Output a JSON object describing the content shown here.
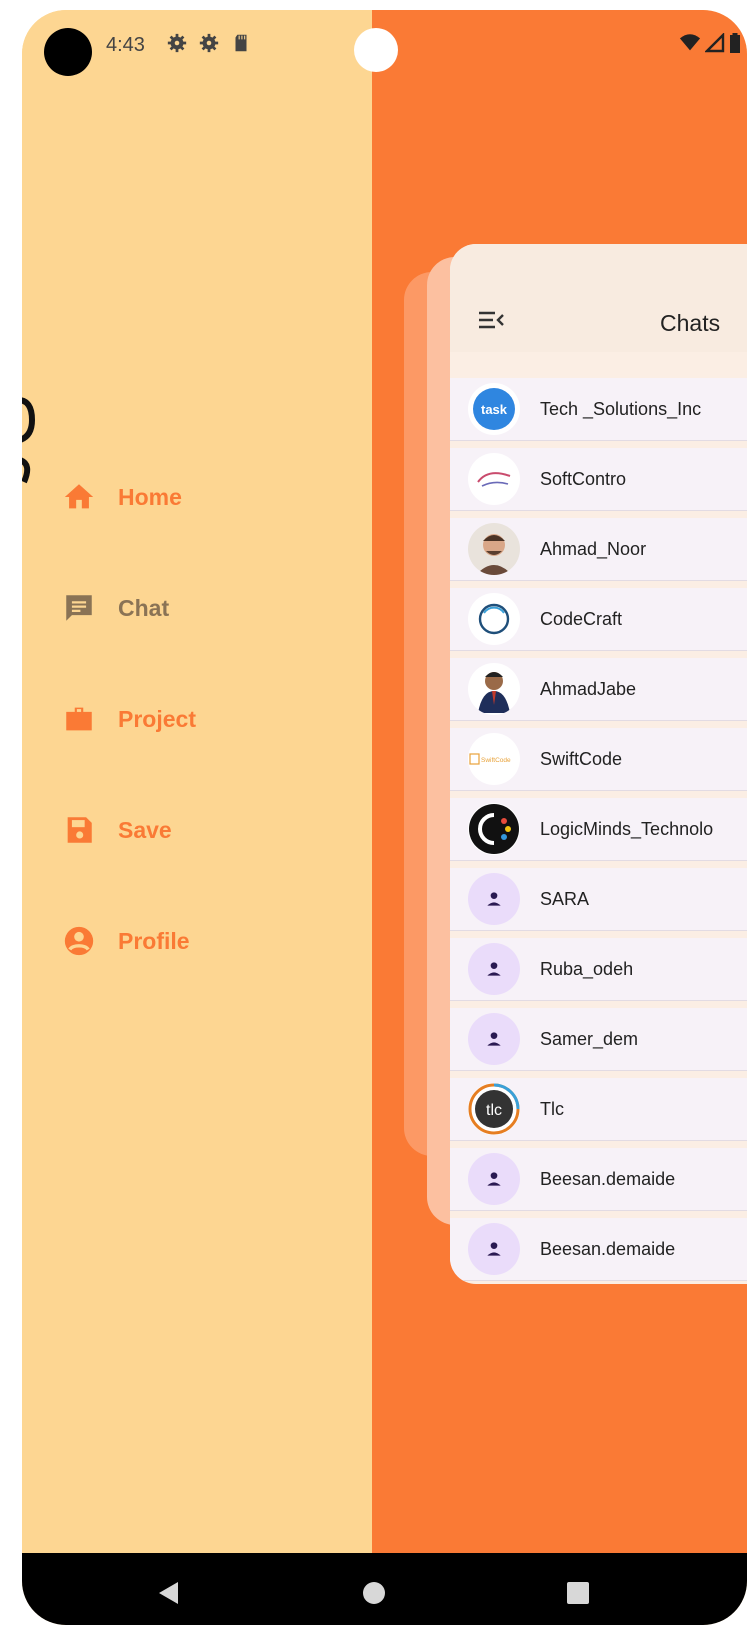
{
  "status": {
    "time": "4:43"
  },
  "menu": {
    "items": [
      {
        "label": "Home"
      },
      {
        "label": "Chat"
      },
      {
        "label": "Project"
      },
      {
        "label": "Save"
      },
      {
        "label": "Profile"
      }
    ]
  },
  "chats": {
    "title": "Chats",
    "items": [
      {
        "name": "Tech _Solutions_Inc"
      },
      {
        "name": "SoftContro"
      },
      {
        "name": "Ahmad_Noor"
      },
      {
        "name": "CodeCraft"
      },
      {
        "name": "AhmadJabe"
      },
      {
        "name": "SwiftCode"
      },
      {
        "name": "LogicMinds_Technolo"
      },
      {
        "name": "SARA"
      },
      {
        "name": "Ruba_odeh"
      },
      {
        "name": "Samer_dem"
      },
      {
        "name": "Tlc"
      },
      {
        "name": "Beesan.demaide"
      },
      {
        "name": "Beesan.demaide"
      }
    ],
    "avatar_logos": {
      "task": "task",
      "tlc": "tlc",
      "swiftcode": "SwiftCode"
    }
  },
  "colors": {
    "drawer_bg": "#fdd692",
    "accent": "#fa7a35",
    "chat_muted": "#8a7355"
  }
}
